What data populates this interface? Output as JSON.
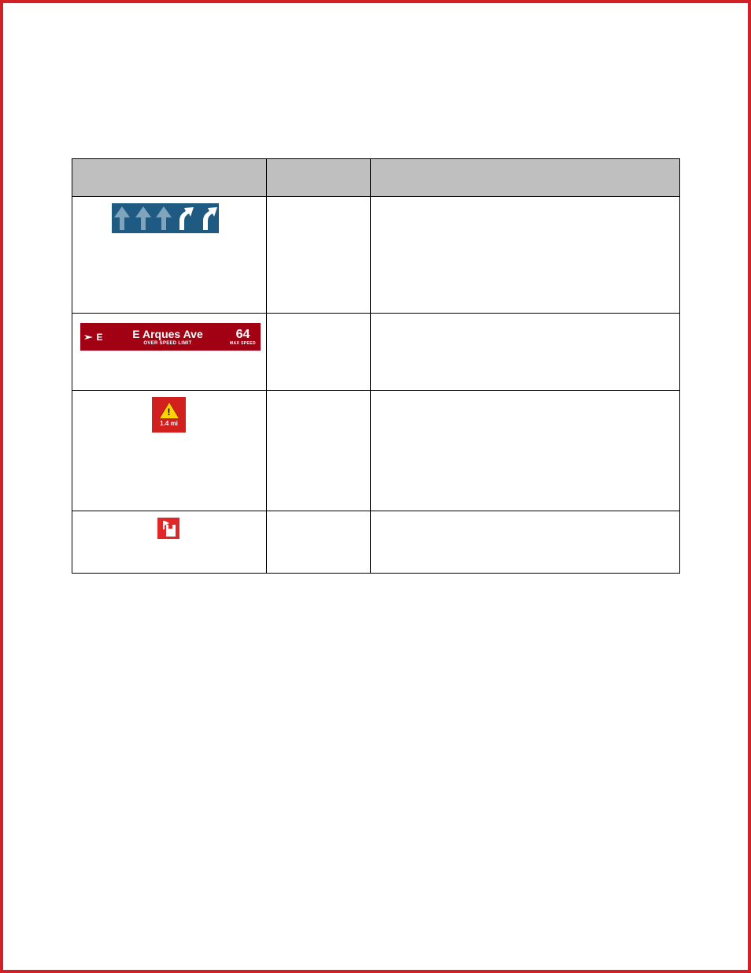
{
  "table": {
    "headers": [
      "",
      "",
      ""
    ],
    "rows": [
      {
        "icon": "lane-guidance",
        "name": "",
        "description": ""
      },
      {
        "icon": "speed-limit-bar",
        "compass_dir": "E",
        "road_name": "E Arques Ave",
        "over_label": "OVER SPEED LIMIT",
        "speed_value": "64",
        "max_label": "MAX SPEED",
        "name": "",
        "description": ""
      },
      {
        "icon": "traffic-warning",
        "bang": "!",
        "distance": "1.4 mi",
        "name": "",
        "description": ""
      },
      {
        "icon": "flag-marker",
        "name": "",
        "description": ""
      }
    ]
  }
}
